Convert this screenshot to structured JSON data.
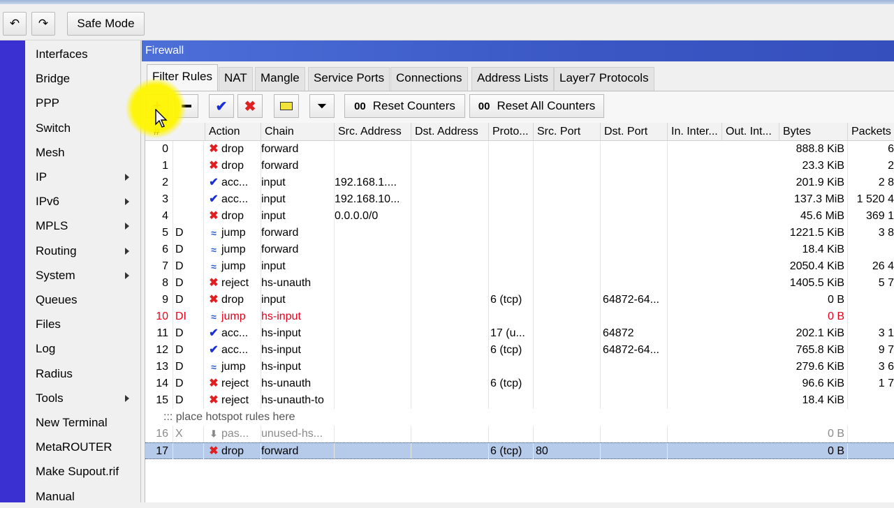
{
  "toolbar": {
    "safe_mode_label": "Safe Mode"
  },
  "menu": [
    {
      "label": "Interfaces",
      "submenu": false
    },
    {
      "label": "Bridge",
      "submenu": false
    },
    {
      "label": "PPP",
      "submenu": false
    },
    {
      "label": "Switch",
      "submenu": false
    },
    {
      "label": "Mesh",
      "submenu": false
    },
    {
      "label": "IP",
      "submenu": true
    },
    {
      "label": "IPv6",
      "submenu": true
    },
    {
      "label": "MPLS",
      "submenu": true
    },
    {
      "label": "Routing",
      "submenu": true
    },
    {
      "label": "System",
      "submenu": true
    },
    {
      "label": "Queues",
      "submenu": false
    },
    {
      "label": "Files",
      "submenu": false
    },
    {
      "label": "Log",
      "submenu": false
    },
    {
      "label": "Radius",
      "submenu": false
    },
    {
      "label": "Tools",
      "submenu": true
    },
    {
      "label": "New Terminal",
      "submenu": false
    },
    {
      "label": "MetaROUTER",
      "submenu": false
    },
    {
      "label": "Make Supout.rif",
      "submenu": false
    },
    {
      "label": "Manual",
      "submenu": false
    }
  ],
  "window": {
    "title": "Firewall"
  },
  "tabs": [
    "Filter Rules",
    "NAT",
    "Mangle",
    "Service Ports",
    "Connections",
    "Address Lists",
    "Layer7 Protocols"
  ],
  "buttons": {
    "reset_counters": "Reset Counters",
    "reset_all_counters": "Reset All Counters",
    "counter_prefix": "00"
  },
  "columns": [
    "#",
    "Action",
    "Chain",
    "Src. Address",
    "Dst. Address",
    "Proto...",
    "Src. Port",
    "Dst. Port",
    "In. Inter...",
    "Out. Int...",
    "Bytes",
    "Packets"
  ],
  "rows": [
    {
      "num": "0",
      "flags": "",
      "action": "drop",
      "chain": "forward",
      "src": "",
      "dst": "",
      "proto": "",
      "sport": "",
      "dport": "",
      "bytes": "888.8 KiB",
      "packets": "6",
      "style": ""
    },
    {
      "num": "1",
      "flags": "",
      "action": "drop",
      "chain": "forward",
      "src": "",
      "dst": "",
      "proto": "",
      "sport": "",
      "dport": "",
      "bytes": "23.3 KiB",
      "packets": "2",
      "style": ""
    },
    {
      "num": "2",
      "flags": "",
      "action": "acc...",
      "chain": "input",
      "src": "192.168.1....",
      "dst": "",
      "proto": "",
      "sport": "",
      "dport": "",
      "bytes": "201.9 KiB",
      "packets": "2 8",
      "style": ""
    },
    {
      "num": "3",
      "flags": "",
      "action": "acc...",
      "chain": "input",
      "src": "192.168.10...",
      "dst": "",
      "proto": "",
      "sport": "",
      "dport": "",
      "bytes": "137.3 MiB",
      "packets": "1 520 4",
      "style": ""
    },
    {
      "num": "4",
      "flags": "",
      "action": "drop",
      "chain": "input",
      "src": "0.0.0.0/0",
      "dst": "",
      "proto": "",
      "sport": "",
      "dport": "",
      "bytes": "45.6 MiB",
      "packets": "369 1",
      "style": ""
    },
    {
      "num": "5",
      "flags": "D",
      "action": "jump",
      "chain": "forward",
      "src": "",
      "dst": "",
      "proto": "",
      "sport": "",
      "dport": "",
      "bytes": "1221.5 KiB",
      "packets": "3 8",
      "style": ""
    },
    {
      "num": "6",
      "flags": "D",
      "action": "jump",
      "chain": "forward",
      "src": "",
      "dst": "",
      "proto": "",
      "sport": "",
      "dport": "",
      "bytes": "18.4 KiB",
      "packets": "",
      "style": ""
    },
    {
      "num": "7",
      "flags": "D",
      "action": "jump",
      "chain": "input",
      "src": "",
      "dst": "",
      "proto": "",
      "sport": "",
      "dport": "",
      "bytes": "2050.4 KiB",
      "packets": "26 4",
      "style": ""
    },
    {
      "num": "8",
      "flags": "D",
      "action": "reject",
      "chain": "hs-unauth",
      "src": "",
      "dst": "",
      "proto": "",
      "sport": "",
      "dport": "",
      "bytes": "1405.5 KiB",
      "packets": "5 7",
      "style": ""
    },
    {
      "num": "9",
      "flags": "D",
      "action": "drop",
      "chain": "input",
      "src": "",
      "dst": "",
      "proto": "6 (tcp)",
      "sport": "",
      "dport": "64872-64...",
      "bytes": "0 B",
      "packets": "",
      "style": ""
    },
    {
      "num": "10",
      "flags": "DI",
      "action": "jump",
      "chain": "hs-input",
      "src": "",
      "dst": "",
      "proto": "",
      "sport": "",
      "dport": "",
      "bytes": "0 B",
      "packets": "",
      "style": "red"
    },
    {
      "num": "11",
      "flags": "D",
      "action": "acc...",
      "chain": "hs-input",
      "src": "",
      "dst": "",
      "proto": "17 (u...",
      "sport": "",
      "dport": "64872",
      "bytes": "202.1 KiB",
      "packets": "3 1",
      "style": ""
    },
    {
      "num": "12",
      "flags": "D",
      "action": "acc...",
      "chain": "hs-input",
      "src": "",
      "dst": "",
      "proto": "6 (tcp)",
      "sport": "",
      "dport": "64872-64...",
      "bytes": "765.8 KiB",
      "packets": "9 7",
      "style": ""
    },
    {
      "num": "13",
      "flags": "D",
      "action": "jump",
      "chain": "hs-input",
      "src": "",
      "dst": "",
      "proto": "",
      "sport": "",
      "dport": "",
      "bytes": "279.6 KiB",
      "packets": "3 6",
      "style": ""
    },
    {
      "num": "14",
      "flags": "D",
      "action": "reject",
      "chain": "hs-unauth",
      "src": "",
      "dst": "",
      "proto": "6 (tcp)",
      "sport": "",
      "dport": "",
      "bytes": "96.6 KiB",
      "packets": "1 7",
      "style": ""
    },
    {
      "num": "15",
      "flags": "D",
      "action": "reject",
      "chain": "hs-unauth-to",
      "src": "",
      "dst": "",
      "proto": "",
      "sport": "",
      "dport": "",
      "bytes": "18.4 KiB",
      "packets": "",
      "style": ""
    },
    {
      "comment": "::: place hotspot rules here"
    },
    {
      "num": "16",
      "flags": "X",
      "action": "pas...",
      "chain": "unused-hs...",
      "src": "",
      "dst": "",
      "proto": "",
      "sport": "",
      "dport": "",
      "bytes": "0 B",
      "packets": "",
      "style": "dis"
    },
    {
      "num": "17",
      "flags": "",
      "action": "drop",
      "chain": "forward",
      "src": "",
      "dst": "",
      "proto": "6 (tcp)",
      "sport": "80",
      "dport": "",
      "bytes": "0 B",
      "packets": "",
      "style": "sel"
    }
  ]
}
